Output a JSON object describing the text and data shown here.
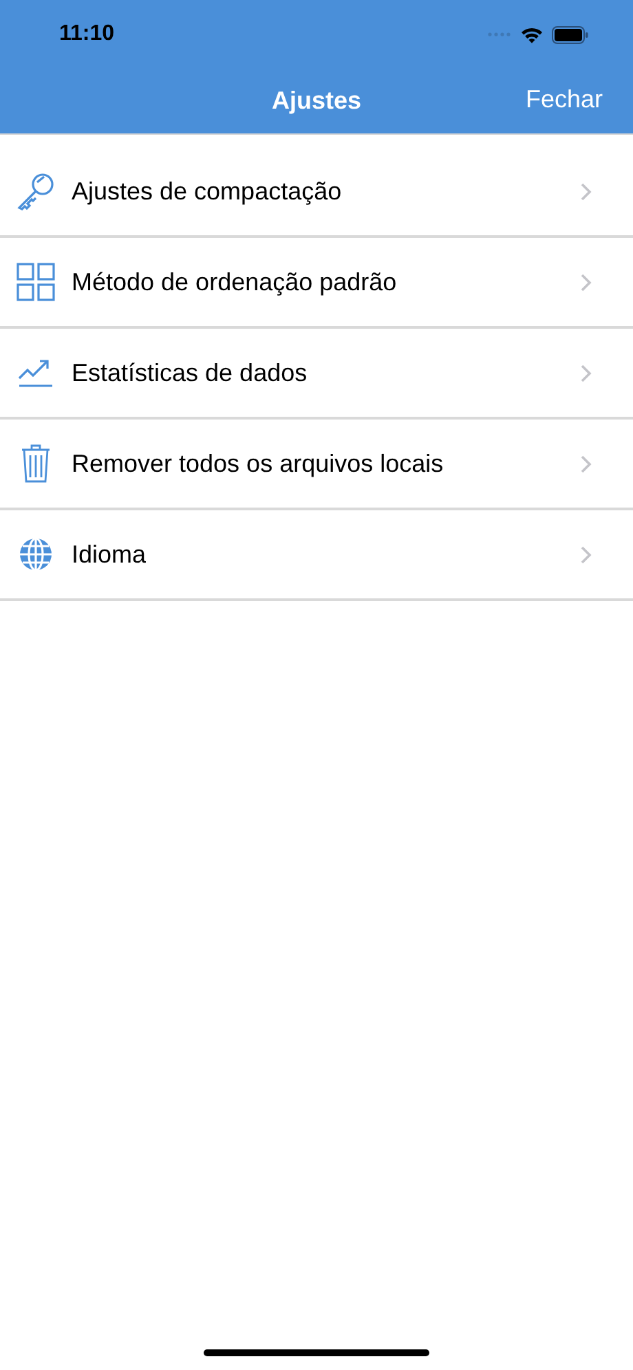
{
  "status_bar": {
    "time": "11:10"
  },
  "nav_bar": {
    "title": "Ajustes",
    "action": "Fechar"
  },
  "items": [
    {
      "kind": "key",
      "label": "Ajustes de compactação"
    },
    {
      "kind": "grid",
      "label": "Método de ordenação padrão"
    },
    {
      "kind": "chart",
      "label": "Estatísticas de dados"
    },
    {
      "kind": "trash",
      "label": "Remover todos os arquivos locais"
    },
    {
      "kind": "globe",
      "label": "Idioma"
    }
  ]
}
